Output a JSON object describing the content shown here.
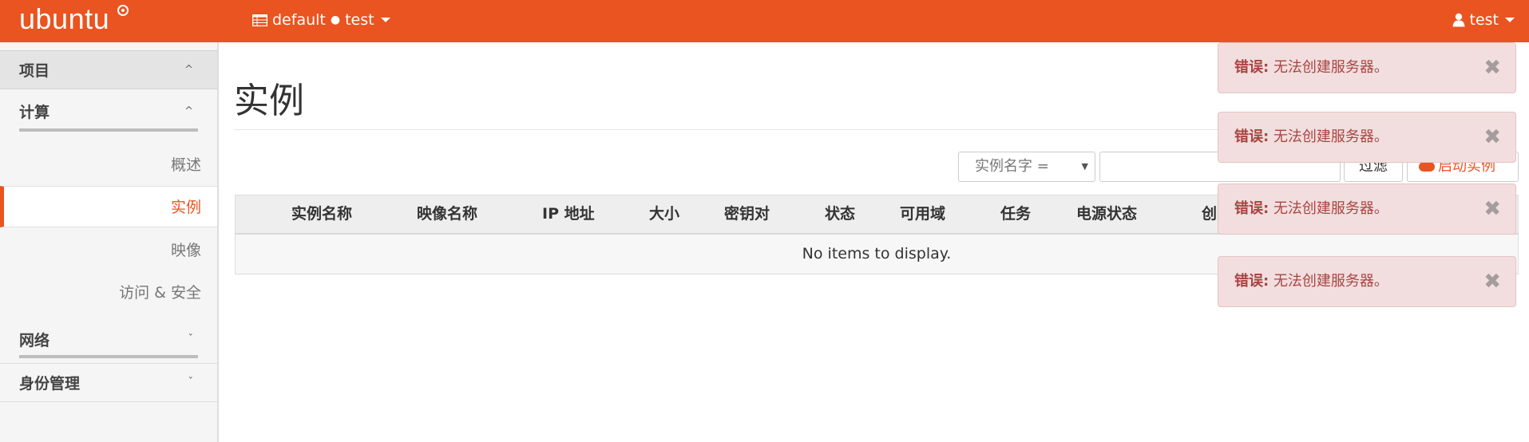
{
  "brand": {
    "logo_text": "ubuntu"
  },
  "nav": {
    "project_domain": "default",
    "project_name": "test",
    "user_name": "test"
  },
  "sidebar": {
    "sections": [
      {
        "label": "项目",
        "expanded": true
      },
      {
        "label": "计算",
        "expanded": true
      },
      {
        "label": "网络",
        "expanded": false
      },
      {
        "label": "身份管理",
        "expanded": false
      }
    ],
    "compute_items": [
      {
        "label": "概述",
        "active": false
      },
      {
        "label": "实例",
        "active": true
      },
      {
        "label": "映像",
        "active": false
      },
      {
        "label": "访问 & 安全",
        "active": false
      }
    ]
  },
  "page": {
    "title": "实例",
    "filter_select": "实例名字 =",
    "filter_input_value": "",
    "filter_button": "过滤",
    "launch_button": "启动实例"
  },
  "table": {
    "columns": [
      "实例名称",
      "映像名称",
      "IP 地址",
      "大小",
      "密钥对",
      "状态",
      "可用域",
      "任务",
      "电源状态",
      "创"
    ],
    "empty_message": "No items to display."
  },
  "toasts": [
    {
      "label": "错误:",
      "message": "无法创建服务器。"
    },
    {
      "label": "错误:",
      "message": "无法创建服务器。"
    },
    {
      "label": "错误:",
      "message": "无法创建服务器。"
    },
    {
      "label": "错误:",
      "message": "无法创建服务器。"
    }
  ],
  "colors": {
    "brand": "#e95420",
    "error_bg": "#f2dede",
    "error_text": "#a94442"
  }
}
